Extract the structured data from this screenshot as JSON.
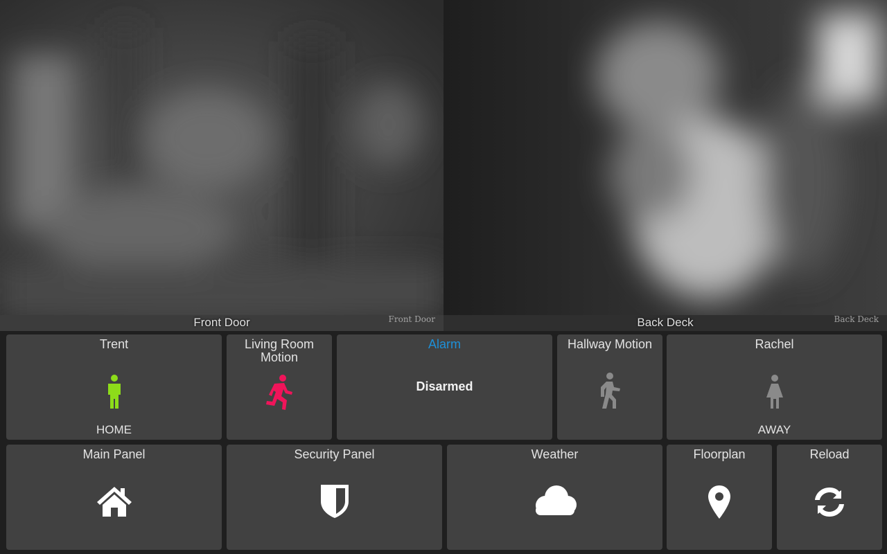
{
  "cameras": [
    {
      "name": "Front Door",
      "stamp": "Front Door"
    },
    {
      "name": "Back Deck",
      "stamp": "Back Deck"
    }
  ],
  "row1": {
    "trent": {
      "title": "Trent",
      "state": "HOME",
      "icon": "person-standing-icon",
      "color": "#8ddc1a"
    },
    "living_room_motion": {
      "title": "Living Room Motion",
      "icon": "person-running-icon",
      "color": "#f0145a"
    },
    "alarm": {
      "title": "Alarm",
      "status": "Disarmed",
      "title_color": "#1e90d8"
    },
    "hallway_motion": {
      "title": "Hallway Motion",
      "icon": "person-walking-icon",
      "color": "#8a8a8a"
    },
    "rachel": {
      "title": "Rachel",
      "state": "AWAY",
      "icon": "person-female-icon",
      "color": "#8a8a8a"
    }
  },
  "row2": {
    "main_panel": {
      "title": "Main Panel",
      "icon": "home-icon"
    },
    "security_panel": {
      "title": "Security Panel",
      "icon": "shield-icon"
    },
    "weather": {
      "title": "Weather",
      "icon": "cloud-icon"
    },
    "floorplan": {
      "title": "Floorplan",
      "icon": "map-pin-icon"
    },
    "reload": {
      "title": "Reload",
      "icon": "refresh-icon"
    }
  }
}
